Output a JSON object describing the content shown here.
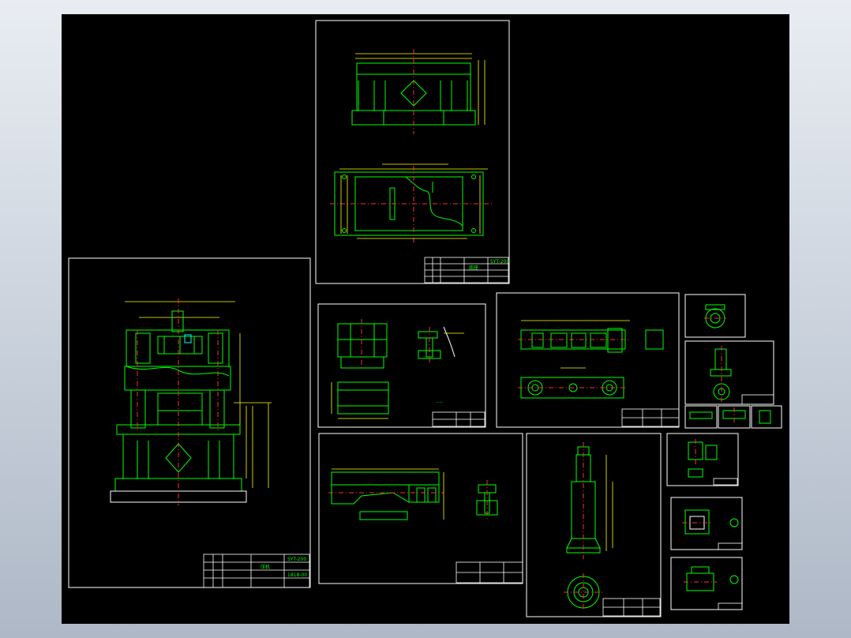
{
  "drawing_sheets": [
    {
      "id": "frame-base",
      "title_block": {
        "code": "SYT-200",
        "name": "底座"
      }
    },
    {
      "id": "assembly",
      "title_block": {
        "code": "SYT-200",
        "name": "压机",
        "number": "1818-00"
      }
    }
  ],
  "colors": {
    "background": "#000000",
    "sheet_border": "#ffffff",
    "outline": "#00ff00",
    "centerline": "#ff3030",
    "dimension": "#ffff00",
    "window_bg_gradient": [
      "#e9edf2",
      "#aeb8c6"
    ]
  }
}
